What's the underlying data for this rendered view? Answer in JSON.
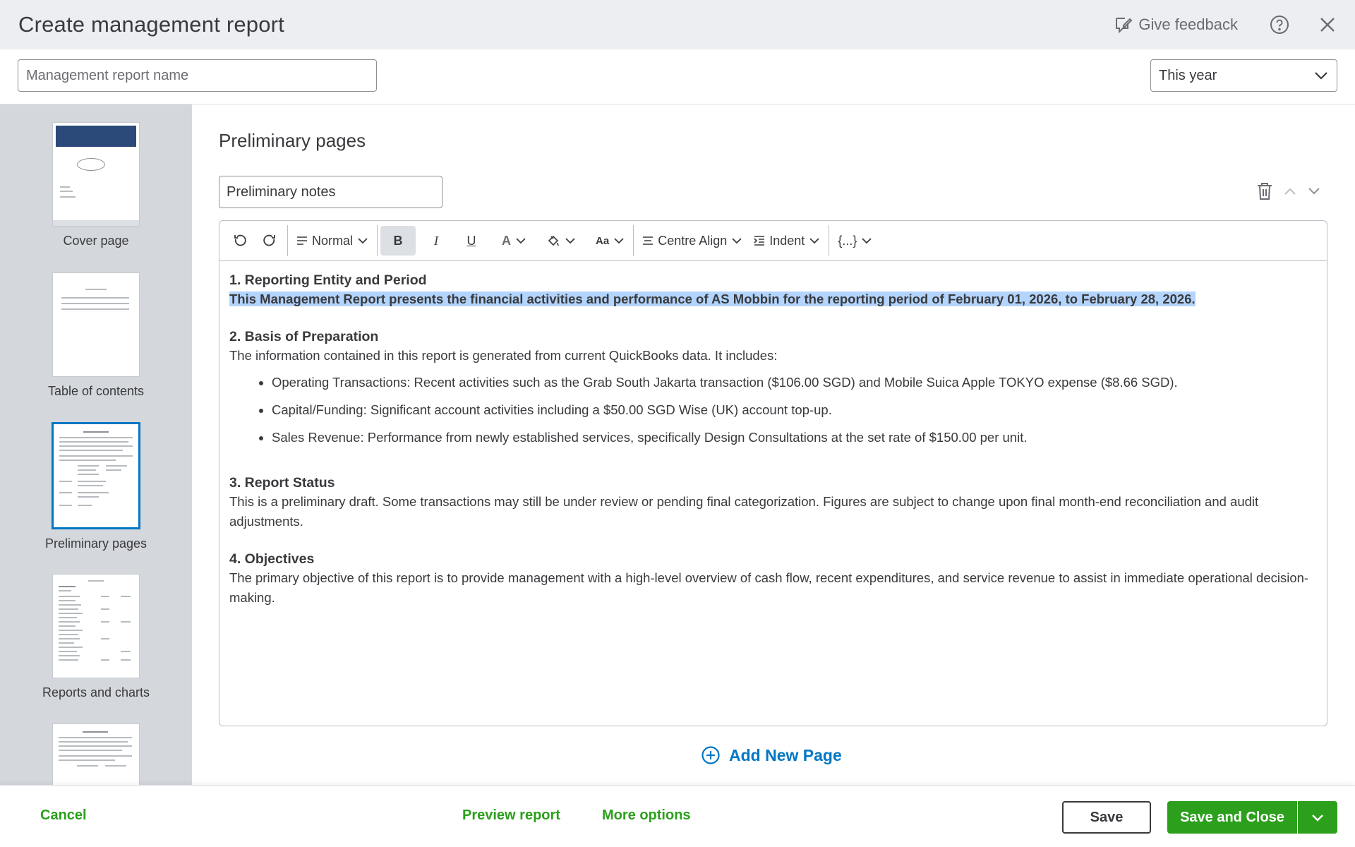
{
  "header": {
    "title": "Create management report",
    "feedback_label": "Give feedback"
  },
  "name_row": {
    "name_placeholder": "Management report name",
    "period_value": "This year"
  },
  "sidebar": {
    "items": [
      {
        "label": "Cover page"
      },
      {
        "label": "Table of contents"
      },
      {
        "label": "Preliminary pages"
      },
      {
        "label": "Reports and charts"
      },
      {
        "label": ""
      }
    ],
    "active_item": "Preliminary pages"
  },
  "main": {
    "section_title": "Preliminary pages",
    "page_name_value": "Preliminary notes",
    "toolbar": {
      "style_label": "Normal",
      "bold_label": "B",
      "italic_label": "I",
      "underline_label": "U",
      "font_color_label": "A",
      "font_size_label": "Aa",
      "align_label": "Centre Align",
      "indent_label": "Indent",
      "fields_label": "{...}"
    },
    "content": {
      "h1": "1. Reporting Entity and Period",
      "p1": "This Management Report presents the financial activities and performance of AS Mobbin for the reporting period of February 01, 2026, to February 28, 2026.",
      "h2": "2. Basis of Preparation",
      "p2": "The information contained in this report is generated from current QuickBooks data. It includes:",
      "bullets": [
        "Operating Transactions: Recent activities such as the Grab South Jakarta transaction ($106.00 SGD) and Mobile Suica Apple TOKYO expense ($8.66 SGD).",
        "Capital/Funding: Significant account activities including a $50.00 SGD Wise (UK) account top-up.",
        "Sales Revenue: Performance from newly established services, specifically Design Consultations at the set rate of $150.00 per unit."
      ],
      "h3": "3. Report Status",
      "p3": "This is a preliminary draft. Some transactions may still be under review or pending final categorization. Figures are subject to change upon final month-end reconciliation and audit adjustments.",
      "h4": "4. Objectives",
      "p4": "The primary objective of this report is to provide management with a high-level overview of cash flow, recent expenditures, and service revenue to assist in immediate operational decision-making."
    },
    "add_page_label": "Add New Page"
  },
  "footer": {
    "cancel_label": "Cancel",
    "preview_label": "Preview report",
    "more_label": "More options",
    "save_label": "Save",
    "save_close_label": "Save and Close"
  },
  "colors": {
    "accent_green": "#2ca01c",
    "link_blue": "#0077c5",
    "header_bg": "#eceef1",
    "sidebar_bg": "#d4d7dc",
    "selection": "#b3d4fc"
  }
}
